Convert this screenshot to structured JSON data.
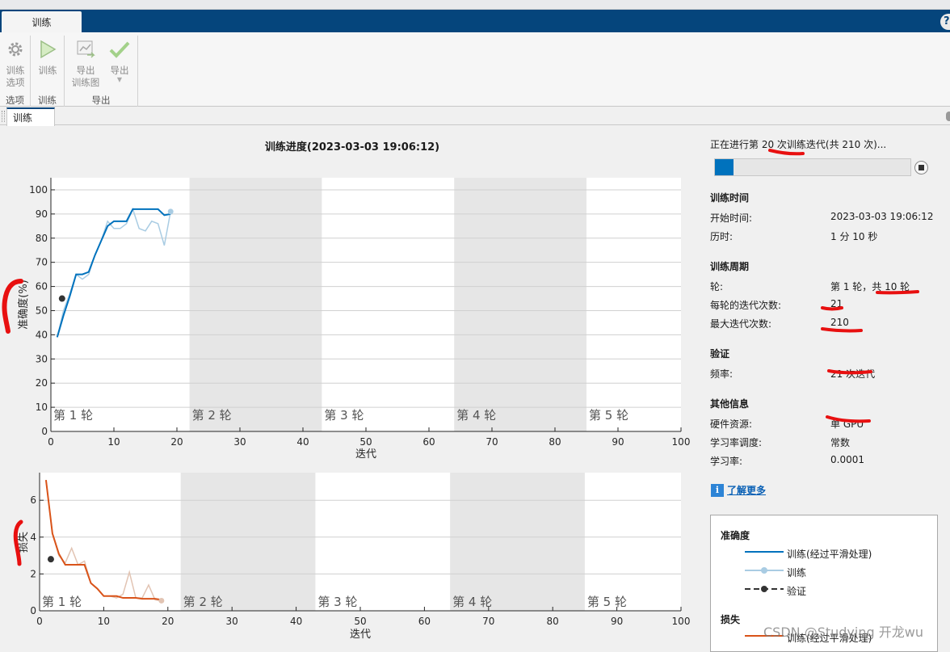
{
  "ribbon": {
    "tab": "训练",
    "help": "?"
  },
  "toolstrip": {
    "groups": [
      {
        "label": "选项",
        "buttons": [
          {
            "label": "训练\n选项",
            "icon": "gear-icon"
          }
        ]
      },
      {
        "label": "训练",
        "buttons": [
          {
            "label": "训练",
            "icon": "play-icon"
          }
        ]
      },
      {
        "label": "导出",
        "buttons": [
          {
            "label": "导出\n训练图",
            "icon": "export-plot-icon"
          },
          {
            "label": "导出",
            "icon": "checkmark-icon"
          }
        ]
      }
    ]
  },
  "doc_tab": "训练",
  "plot_title": "训练进度(2023-03-03 19:06:12)",
  "epoch_labels": [
    "第 1 轮",
    "第 2 轮",
    "第 3 轮",
    "第 4 轮",
    "第 5 轮"
  ],
  "chart_data": [
    {
      "type": "line",
      "ylabel": "准确度(%)",
      "xlabel": "迭代",
      "xlim": [
        0,
        100
      ],
      "ylim": [
        0,
        105
      ],
      "xticks": [
        0,
        10,
        20,
        30,
        40,
        50,
        60,
        70,
        80,
        90,
        100
      ],
      "yticks": [
        0,
        10,
        20,
        30,
        40,
        50,
        60,
        70,
        80,
        90,
        100
      ],
      "epoch_bounds": [
        0,
        22,
        43,
        64,
        85,
        100
      ],
      "series": [
        {
          "name": "训练(经过平滑处理)",
          "color": "#0072bd",
          "x": [
            1,
            2,
            3,
            4,
            5,
            6,
            7,
            8,
            9,
            10,
            11,
            12,
            13,
            14,
            15,
            16,
            17,
            18,
            19
          ],
          "y": [
            39,
            48,
            56,
            65,
            65,
            66,
            73,
            79,
            85,
            87,
            87,
            87,
            92,
            92,
            92,
            92,
            92,
            89.5,
            90
          ]
        },
        {
          "name": "训练",
          "color": "#a9cce3",
          "x": [
            1,
            2,
            3,
            4,
            5,
            6,
            7,
            8,
            9,
            10,
            11,
            12,
            13,
            14,
            15,
            16,
            17,
            18,
            19
          ],
          "y": [
            39,
            50,
            57,
            65,
            63,
            65,
            73,
            79,
            87,
            84,
            84,
            86,
            92,
            84,
            83,
            87,
            86,
            77,
            91
          ]
        },
        {
          "name": "验证",
          "color": "#333333",
          "x": [
            1
          ],
          "y": [
            55
          ]
        }
      ]
    },
    {
      "type": "line",
      "ylabel": "损失",
      "xlabel": "迭代",
      "xlim": [
        0,
        100
      ],
      "ylim": [
        0,
        7.5
      ],
      "xticks": [
        0,
        10,
        20,
        30,
        40,
        50,
        60,
        70,
        80,
        90,
        100
      ],
      "yticks": [
        0,
        2,
        4,
        6
      ],
      "epoch_bounds": [
        0,
        22,
        43,
        64,
        85,
        100
      ],
      "series": [
        {
          "name": "训练(经过平滑处理)",
          "color": "#d95319",
          "x": [
            1,
            2,
            3,
            4,
            5,
            6,
            7,
            8,
            9,
            10,
            11,
            12,
            13,
            14,
            15,
            16,
            17,
            18,
            19
          ],
          "y": [
            7.1,
            4.2,
            3.1,
            2.5,
            2.5,
            2.5,
            2.5,
            1.5,
            1.2,
            0.8,
            0.8,
            0.8,
            0.7,
            0.7,
            0.7,
            0.65,
            0.65,
            0.65,
            0.6
          ]
        },
        {
          "name": "训练",
          "color": "#e2c4b3",
          "x": [
            1,
            2,
            3,
            4,
            5,
            6,
            7,
            8,
            9,
            10,
            11,
            12,
            13,
            14,
            15,
            16,
            17,
            18,
            19
          ],
          "y": [
            7.1,
            4.2,
            3.0,
            2.6,
            3.4,
            2.5,
            2.7,
            1.5,
            1.2,
            0.8,
            0.8,
            0.7,
            0.9,
            2.1,
            0.7,
            0.7,
            1.4,
            0.6,
            0.55
          ]
        },
        {
          "name": "验证",
          "color": "#333333",
          "x": [
            1
          ],
          "y": [
            2.8
          ]
        }
      ]
    }
  ],
  "status": {
    "text": "正在进行第 20 次训练迭代(共 210 次)...",
    "progress": 0.095
  },
  "sections": [
    {
      "title": "训练时间",
      "rows": [
        {
          "k": "开始时间:",
          "v": "2023-03-03 19:06:12"
        },
        {
          "k": "历时:",
          "v": "1 分 10 秒"
        }
      ]
    },
    {
      "title": "训练周期",
      "rows": [
        {
          "k": "轮:",
          "v": "第 1 轮，共 10 轮"
        },
        {
          "k": "每轮的迭代次数:",
          "v": "21"
        },
        {
          "k": "最大迭代次数:",
          "v": "210"
        }
      ]
    },
    {
      "title": "验证",
      "rows": [
        {
          "k": "频率:",
          "v": "21 次迭代"
        }
      ]
    },
    {
      "title": "其他信息",
      "rows": [
        {
          "k": "硬件资源:",
          "v": "单 GPU"
        },
        {
          "k": "学习率调度:",
          "v": "常数"
        },
        {
          "k": "学习率:",
          "v": "0.0001"
        }
      ]
    }
  ],
  "learn_more": "了解更多",
  "legend": {
    "accuracy_title": "准确度",
    "items": [
      "训练(经过平滑处理)",
      "训练",
      "验证"
    ],
    "loss_title": "损失",
    "loss_item": "训练(经过平滑处理)"
  },
  "watermark": "CSDN @Studying 开龙wu",
  "colors": {
    "ribbon": "#05457c",
    "accent": "#0072bd",
    "loss": "#d95319",
    "annotation": "#e81010"
  }
}
